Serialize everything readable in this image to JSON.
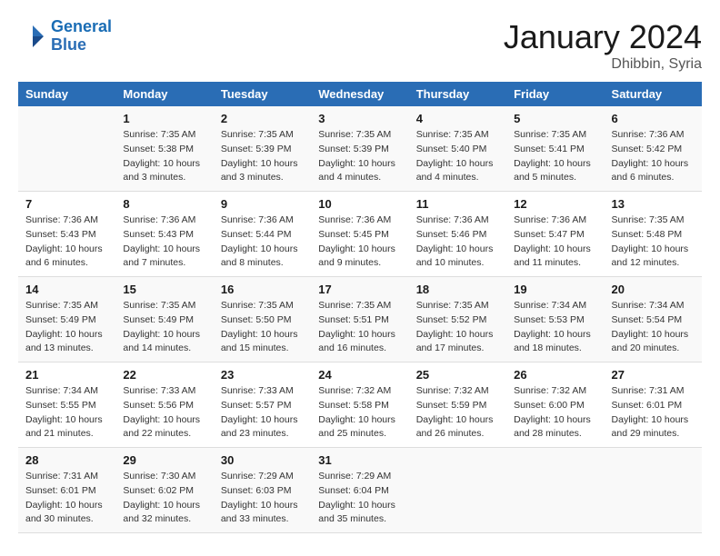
{
  "header": {
    "logo_line1": "General",
    "logo_line2": "Blue",
    "month_title": "January 2024",
    "location": "Dhibbin, Syria"
  },
  "days_of_week": [
    "Sunday",
    "Monday",
    "Tuesday",
    "Wednesday",
    "Thursday",
    "Friday",
    "Saturday"
  ],
  "weeks": [
    [
      {
        "day": "",
        "sunrise": "",
        "sunset": "",
        "daylight": ""
      },
      {
        "day": "1",
        "sunrise": "Sunrise: 7:35 AM",
        "sunset": "Sunset: 5:38 PM",
        "daylight": "Daylight: 10 hours and 3 minutes."
      },
      {
        "day": "2",
        "sunrise": "Sunrise: 7:35 AM",
        "sunset": "Sunset: 5:39 PM",
        "daylight": "Daylight: 10 hours and 3 minutes."
      },
      {
        "day": "3",
        "sunrise": "Sunrise: 7:35 AM",
        "sunset": "Sunset: 5:39 PM",
        "daylight": "Daylight: 10 hours and 4 minutes."
      },
      {
        "day": "4",
        "sunrise": "Sunrise: 7:35 AM",
        "sunset": "Sunset: 5:40 PM",
        "daylight": "Daylight: 10 hours and 4 minutes."
      },
      {
        "day": "5",
        "sunrise": "Sunrise: 7:35 AM",
        "sunset": "Sunset: 5:41 PM",
        "daylight": "Daylight: 10 hours and 5 minutes."
      },
      {
        "day": "6",
        "sunrise": "Sunrise: 7:36 AM",
        "sunset": "Sunset: 5:42 PM",
        "daylight": "Daylight: 10 hours and 6 minutes."
      }
    ],
    [
      {
        "day": "7",
        "sunrise": "Sunrise: 7:36 AM",
        "sunset": "Sunset: 5:43 PM",
        "daylight": "Daylight: 10 hours and 6 minutes."
      },
      {
        "day": "8",
        "sunrise": "Sunrise: 7:36 AM",
        "sunset": "Sunset: 5:43 PM",
        "daylight": "Daylight: 10 hours and 7 minutes."
      },
      {
        "day": "9",
        "sunrise": "Sunrise: 7:36 AM",
        "sunset": "Sunset: 5:44 PM",
        "daylight": "Daylight: 10 hours and 8 minutes."
      },
      {
        "day": "10",
        "sunrise": "Sunrise: 7:36 AM",
        "sunset": "Sunset: 5:45 PM",
        "daylight": "Daylight: 10 hours and 9 minutes."
      },
      {
        "day": "11",
        "sunrise": "Sunrise: 7:36 AM",
        "sunset": "Sunset: 5:46 PM",
        "daylight": "Daylight: 10 hours and 10 minutes."
      },
      {
        "day": "12",
        "sunrise": "Sunrise: 7:36 AM",
        "sunset": "Sunset: 5:47 PM",
        "daylight": "Daylight: 10 hours and 11 minutes."
      },
      {
        "day": "13",
        "sunrise": "Sunrise: 7:35 AM",
        "sunset": "Sunset: 5:48 PM",
        "daylight": "Daylight: 10 hours and 12 minutes."
      }
    ],
    [
      {
        "day": "14",
        "sunrise": "Sunrise: 7:35 AM",
        "sunset": "Sunset: 5:49 PM",
        "daylight": "Daylight: 10 hours and 13 minutes."
      },
      {
        "day": "15",
        "sunrise": "Sunrise: 7:35 AM",
        "sunset": "Sunset: 5:49 PM",
        "daylight": "Daylight: 10 hours and 14 minutes."
      },
      {
        "day": "16",
        "sunrise": "Sunrise: 7:35 AM",
        "sunset": "Sunset: 5:50 PM",
        "daylight": "Daylight: 10 hours and 15 minutes."
      },
      {
        "day": "17",
        "sunrise": "Sunrise: 7:35 AM",
        "sunset": "Sunset: 5:51 PM",
        "daylight": "Daylight: 10 hours and 16 minutes."
      },
      {
        "day": "18",
        "sunrise": "Sunrise: 7:35 AM",
        "sunset": "Sunset: 5:52 PM",
        "daylight": "Daylight: 10 hours and 17 minutes."
      },
      {
        "day": "19",
        "sunrise": "Sunrise: 7:34 AM",
        "sunset": "Sunset: 5:53 PM",
        "daylight": "Daylight: 10 hours and 18 minutes."
      },
      {
        "day": "20",
        "sunrise": "Sunrise: 7:34 AM",
        "sunset": "Sunset: 5:54 PM",
        "daylight": "Daylight: 10 hours and 20 minutes."
      }
    ],
    [
      {
        "day": "21",
        "sunrise": "Sunrise: 7:34 AM",
        "sunset": "Sunset: 5:55 PM",
        "daylight": "Daylight: 10 hours and 21 minutes."
      },
      {
        "day": "22",
        "sunrise": "Sunrise: 7:33 AM",
        "sunset": "Sunset: 5:56 PM",
        "daylight": "Daylight: 10 hours and 22 minutes."
      },
      {
        "day": "23",
        "sunrise": "Sunrise: 7:33 AM",
        "sunset": "Sunset: 5:57 PM",
        "daylight": "Daylight: 10 hours and 23 minutes."
      },
      {
        "day": "24",
        "sunrise": "Sunrise: 7:32 AM",
        "sunset": "Sunset: 5:58 PM",
        "daylight": "Daylight: 10 hours and 25 minutes."
      },
      {
        "day": "25",
        "sunrise": "Sunrise: 7:32 AM",
        "sunset": "Sunset: 5:59 PM",
        "daylight": "Daylight: 10 hours and 26 minutes."
      },
      {
        "day": "26",
        "sunrise": "Sunrise: 7:32 AM",
        "sunset": "Sunset: 6:00 PM",
        "daylight": "Daylight: 10 hours and 28 minutes."
      },
      {
        "day": "27",
        "sunrise": "Sunrise: 7:31 AM",
        "sunset": "Sunset: 6:01 PM",
        "daylight": "Daylight: 10 hours and 29 minutes."
      }
    ],
    [
      {
        "day": "28",
        "sunrise": "Sunrise: 7:31 AM",
        "sunset": "Sunset: 6:01 PM",
        "daylight": "Daylight: 10 hours and 30 minutes."
      },
      {
        "day": "29",
        "sunrise": "Sunrise: 7:30 AM",
        "sunset": "Sunset: 6:02 PM",
        "daylight": "Daylight: 10 hours and 32 minutes."
      },
      {
        "day": "30",
        "sunrise": "Sunrise: 7:29 AM",
        "sunset": "Sunset: 6:03 PM",
        "daylight": "Daylight: 10 hours and 33 minutes."
      },
      {
        "day": "31",
        "sunrise": "Sunrise: 7:29 AM",
        "sunset": "Sunset: 6:04 PM",
        "daylight": "Daylight: 10 hours and 35 minutes."
      },
      {
        "day": "",
        "sunrise": "",
        "sunset": "",
        "daylight": ""
      },
      {
        "day": "",
        "sunrise": "",
        "sunset": "",
        "daylight": ""
      },
      {
        "day": "",
        "sunrise": "",
        "sunset": "",
        "daylight": ""
      }
    ]
  ]
}
